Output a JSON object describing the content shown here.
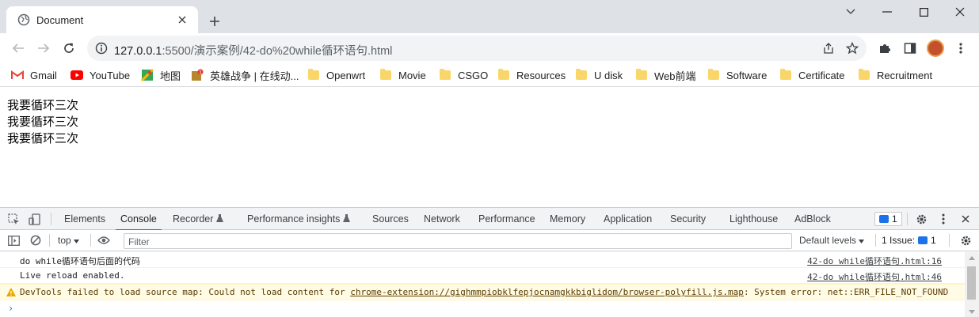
{
  "tab": {
    "title": "Document",
    "close_icon": "close-icon",
    "favicon": "globe-icon"
  },
  "toolbar": {
    "url_host": "127.0.0.1",
    "url_path": ":5500/演示案例/42-do%20while循环语句.html"
  },
  "bookmarks": [
    {
      "label": "Gmail",
      "icon": "gmail-icon"
    },
    {
      "label": "YouTube",
      "icon": "youtube-icon"
    },
    {
      "label": "地图",
      "icon": "maps-icon"
    },
    {
      "label": "英雄战争 | 在线动...",
      "icon": "hero-icon"
    },
    {
      "label": "Openwrt",
      "icon": "folder-icon"
    },
    {
      "label": "Movie",
      "icon": "folder-icon"
    },
    {
      "label": "CSGO",
      "icon": "folder-icon"
    },
    {
      "label": "Resources",
      "icon": "folder-icon"
    },
    {
      "label": "U disk",
      "icon": "folder-icon"
    },
    {
      "label": "Web前端",
      "icon": "folder-icon"
    },
    {
      "label": "Software",
      "icon": "folder-icon"
    },
    {
      "label": "Certificate",
      "icon": "folder-icon"
    },
    {
      "label": "Recruitment",
      "icon": "folder-icon"
    }
  ],
  "page": {
    "lines": [
      "我要循环三次",
      "我要循环三次",
      "我要循环三次"
    ]
  },
  "devtools": {
    "tabs": [
      "Elements",
      "Console",
      "Recorder",
      "Performance insights",
      "Sources",
      "Network",
      "Performance",
      "Memory",
      "Application",
      "Security",
      "Lighthouse",
      "AdBlock"
    ],
    "active_tab": "Console",
    "issues_count": "1",
    "context": "top",
    "filter_placeholder": "Filter",
    "default_levels": "Default levels",
    "issue_label": "1 Issue:",
    "issue_badge_count": "1",
    "messages": [
      {
        "text": "do while循环语句后面的代码",
        "source": "42-do while循环语句.html:16",
        "level": "log"
      },
      {
        "text": "Live reload enabled.",
        "source": "42-do while循环语句.html:46",
        "level": "log"
      }
    ],
    "warning": {
      "prefix": "DevTools failed to load source map: Could not load content for ",
      "link": "chrome-extension://gighmmpiobklfepjocnamgkkbiglidom/browser-polyfill.js.map",
      "suffix": ": System error: net::ERR_FILE_NOT_FOUND"
    },
    "prompt": "›"
  },
  "colors": {
    "accent": "#1a73e8",
    "warning_bg": "#fffbe5",
    "tabstrip": "#dee1e6"
  }
}
